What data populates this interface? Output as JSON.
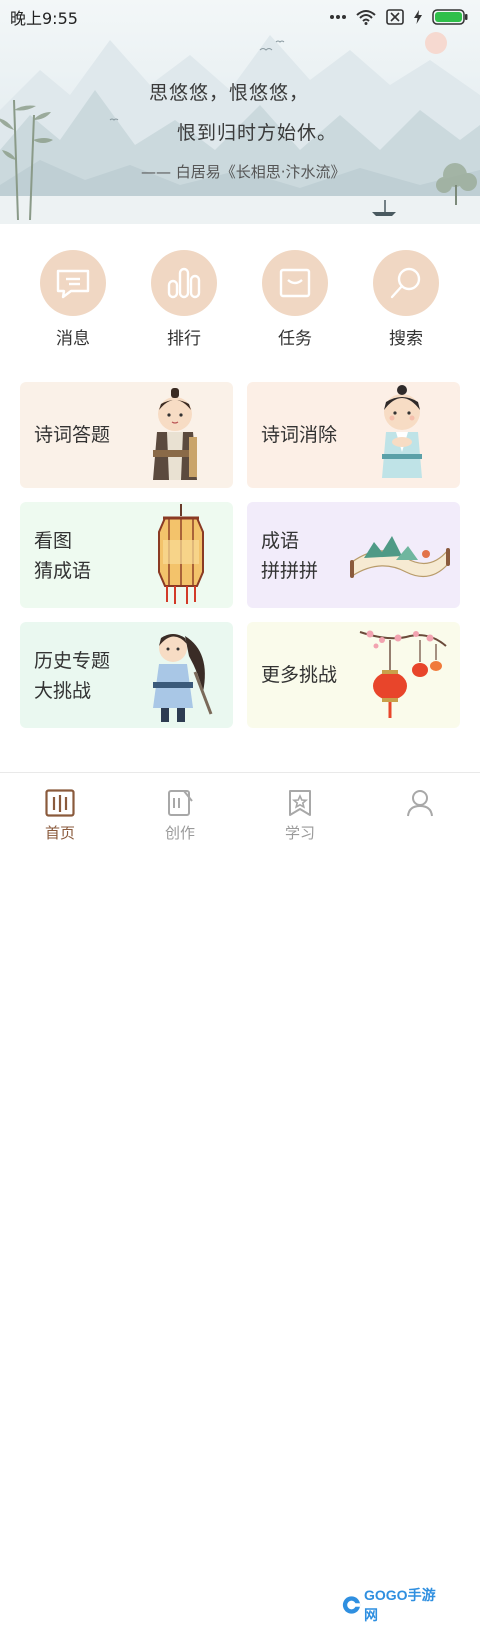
{
  "status_bar": {
    "time": "晚上9:55"
  },
  "banner": {
    "line1": "思悠悠，恨悠悠，",
    "line2": "恨到归时方始休。",
    "source": "—— 白居易《长相思·汴水流》"
  },
  "quick_actions": [
    {
      "label": "消息",
      "icon": "message-icon"
    },
    {
      "label": "排行",
      "icon": "ranking-icon"
    },
    {
      "label": "任务",
      "icon": "task-icon"
    },
    {
      "label": "搜索",
      "icon": "search-icon"
    }
  ],
  "cards": [
    {
      "lines": [
        "诗词答题"
      ],
      "bg": "#faf1e8"
    },
    {
      "lines": [
        "诗词消除"
      ],
      "bg": "#fcefe6"
    },
    {
      "lines": [
        "看图",
        "猜成语"
      ],
      "bg": "#eefaf0"
    },
    {
      "lines": [
        "成语",
        "拼拼拼"
      ],
      "bg": "#f2ecfa"
    },
    {
      "lines": [
        "历史专题",
        "大挑战"
      ],
      "bg": "#eaf8f0"
    },
    {
      "lines": [
        "更多挑战"
      ],
      "bg": "#fafbeb"
    }
  ],
  "bottom_nav": [
    {
      "label": "首页",
      "active": true
    },
    {
      "label": "创作",
      "active": false
    },
    {
      "label": "学习",
      "active": false
    },
    {
      "label": "我的",
      "active": false
    }
  ],
  "watermark": "GOGO手游网",
  "colors": {
    "accent": "#8a5a3c",
    "circle": "#f0d7c3"
  }
}
